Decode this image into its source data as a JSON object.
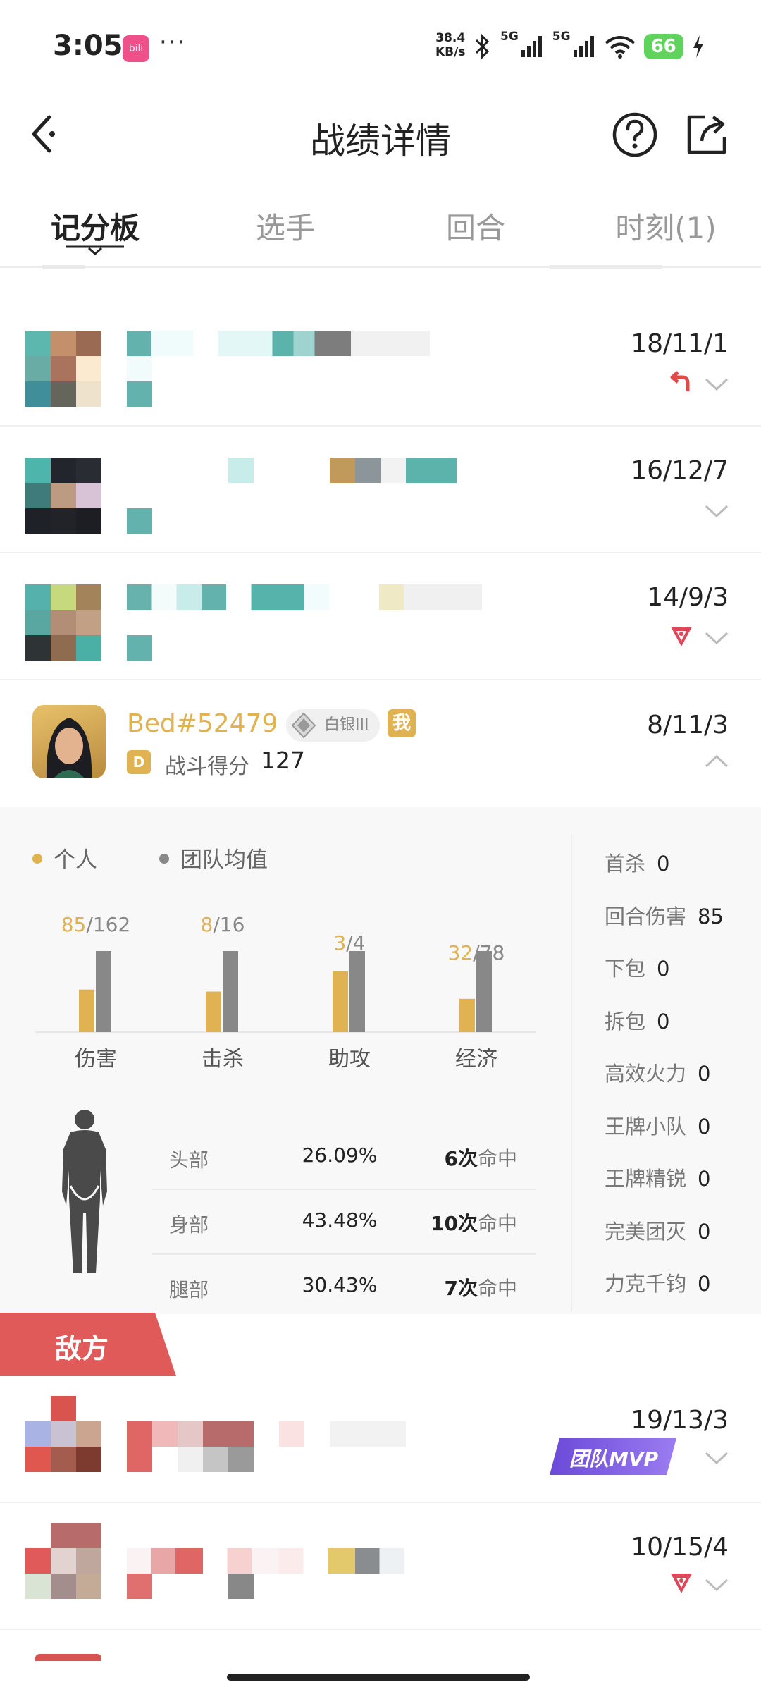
{
  "status_bar": {
    "time": "3:05",
    "app_icon_label": "bili",
    "more": "···",
    "net_speed_value": "38.4",
    "net_speed_unit": "KB/s",
    "sim1": "5G",
    "sim2": "5G",
    "battery": "66"
  },
  "header": {
    "title": "战绩详情"
  },
  "tabs": [
    {
      "label": "记分板"
    },
    {
      "label": "选手"
    },
    {
      "label": "回合"
    },
    {
      "label": "时刻(1)"
    }
  ],
  "rows": [
    {
      "kda": "18/11/1",
      "icon": "return-arrow-icon"
    },
    {
      "kda": "16/12/7",
      "icon": ""
    },
    {
      "kda": "14/9/3",
      "icon": "triangle-logo-icon"
    }
  ],
  "player": {
    "name": "Bed#52479",
    "rank": "白银III",
    "me": "我",
    "grade": "D",
    "combat_label": "战斗得分",
    "combat_score": "127",
    "kda": "8/11/3"
  },
  "legend": {
    "personal": "个人",
    "team_avg": "团队均值"
  },
  "colors": {
    "gold": "#e0b251",
    "gray": "#888888",
    "enemy_red": "#e05a5a",
    "mvp_purple": "#7b5ae0"
  },
  "chart_data": {
    "type": "bar",
    "categories": [
      "伤害",
      "击杀",
      "助攻",
      "经济"
    ],
    "series": [
      {
        "name": "个人",
        "values": [
          85,
          8,
          3,
          32
        ]
      },
      {
        "name": "团队均值",
        "values": [
          162,
          16,
          4,
          78
        ]
      }
    ],
    "value_labels": [
      "85/162",
      "8/16",
      "3/4",
      "32/78"
    ]
  },
  "hits": [
    {
      "part": "头部",
      "pct": "26.09%",
      "count": "6",
      "unit": "次",
      "suffix": "命中"
    },
    {
      "part": "身部",
      "pct": "43.48%",
      "count": "10",
      "unit": "次",
      "suffix": "命中"
    },
    {
      "part": "腿部",
      "pct": "30.43%",
      "count": "7",
      "unit": "次",
      "suffix": "命中"
    }
  ],
  "side_stats": [
    {
      "label": "首杀",
      "value": "0"
    },
    {
      "label": "回合伤害",
      "value": "85"
    },
    {
      "label": "下包",
      "value": "0"
    },
    {
      "label": "拆包",
      "value": "0"
    },
    {
      "label": "高效火力",
      "value": "0"
    },
    {
      "label": "王牌小队",
      "value": "0"
    },
    {
      "label": "王牌精锐",
      "value": "0"
    },
    {
      "label": "完美团灭",
      "value": "0"
    },
    {
      "label": "力克千钧",
      "value": "0"
    }
  ],
  "enemy": {
    "label": "敌方",
    "rows": [
      {
        "kda": "19/13/3",
        "badge": "团队MVP"
      },
      {
        "kda": "10/15/4",
        "icon": "triangle-logo-icon"
      }
    ]
  }
}
